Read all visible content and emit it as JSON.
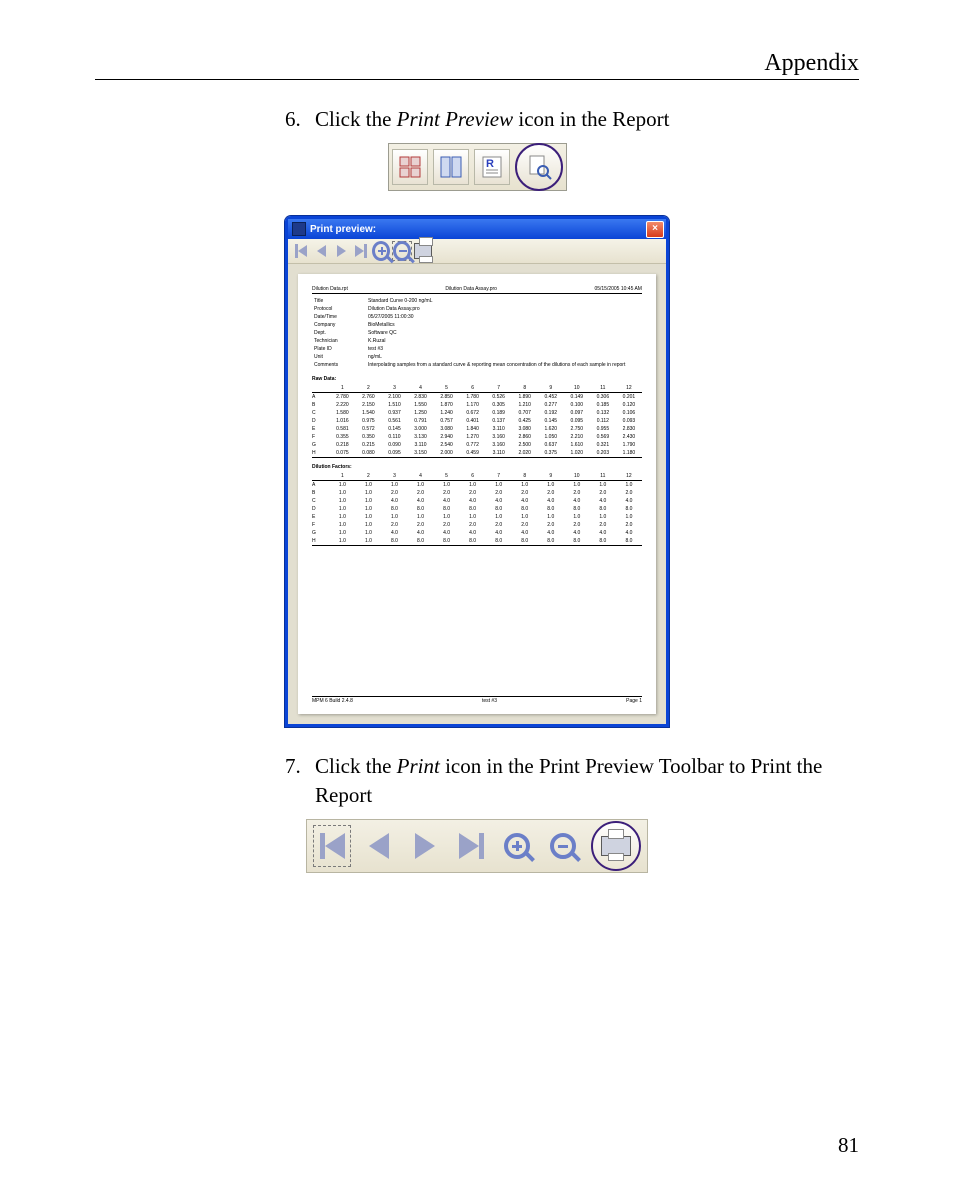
{
  "page_header": "Appendix",
  "page_number": "81",
  "step6": {
    "num": "6.",
    "prefix": "Click the ",
    "italic": "Print Preview",
    "suffix": " icon in the Report"
  },
  "step7": {
    "num": "7.",
    "prefix": "Click the ",
    "italic": "Print",
    "suffix": " icon in the Print Preview Toolbar to Print the Report"
  },
  "tbar1": {
    "btn1": "table-layout-icon",
    "btn2": "column-layout-icon",
    "btn3": "report-icon",
    "selected": "print-preview-icon"
  },
  "win": {
    "title": "Print preview:",
    "close": "×",
    "toolbar": [
      "first",
      "prev",
      "next",
      "last",
      "zoom-in",
      "zoom-out",
      "print"
    ]
  },
  "report": {
    "header_left": "Dilution Data.rpt",
    "header_center": "Dilution Data Assay.pro",
    "header_right": "05/15/2005 10:45 AM",
    "meta": [
      [
        "Title",
        "Standard Curve 0-200 ng/mL"
      ],
      [
        "Protocol",
        "Dilution Data Assay.pro"
      ],
      [
        "Date/Time",
        "05/27/2005 11:00:30"
      ],
      [
        "Company",
        "BioMetallics"
      ],
      [
        "Dept.",
        "Software QC"
      ],
      [
        "Technician",
        "K.Ruzal"
      ],
      [
        "Plate ID",
        "test #3"
      ],
      [
        "Unit",
        "ng/mL"
      ],
      [
        "Comments",
        "Interpolating samples from a standard curve & reporting mean concentration of the dilutions of each sample in report"
      ]
    ],
    "raw_label": "Raw Data:",
    "cols": [
      "",
      "1",
      "2",
      "3",
      "4",
      "5",
      "6",
      "7",
      "8",
      "9",
      "10",
      "11",
      "12"
    ],
    "raw_rows": [
      [
        "A",
        "2.780",
        "2.760",
        "2.100",
        "2.830",
        "2.850",
        "1.780",
        "0.526",
        "1.890",
        "0.452",
        "0.149",
        "0.306",
        "0.201"
      ],
      [
        "B",
        "2.220",
        "2.150",
        "1.510",
        "1.550",
        "1.870",
        "1.170",
        "0.305",
        "1.210",
        "0.277",
        "0.100",
        "0.185",
        "0.120"
      ],
      [
        "C",
        "1.580",
        "1.540",
        "0.937",
        "1.250",
        "1.240",
        "0.672",
        "0.189",
        "0.707",
        "0.192",
        "0.097",
        "0.132",
        "0.106"
      ],
      [
        "D",
        "1.016",
        "0.975",
        "0.561",
        "0.791",
        "0.757",
        "0.401",
        "0.137",
        "0.425",
        "0.145",
        "0.095",
        "0.112",
        "0.093"
      ],
      [
        "E",
        "0.581",
        "0.572",
        "0.145",
        "3.000",
        "3.080",
        "1.840",
        "3.110",
        "3.080",
        "1.620",
        "2.750",
        "0.955",
        "2.830"
      ],
      [
        "F",
        "0.355",
        "0.350",
        "0.110",
        "3.130",
        "2.940",
        "1.270",
        "3.160",
        "2.860",
        "1.050",
        "2.210",
        "0.569",
        "2.430"
      ],
      [
        "G",
        "0.218",
        "0.215",
        "0.090",
        "3.110",
        "2.540",
        "0.772",
        "3.160",
        "2.500",
        "0.637",
        "1.610",
        "0.321",
        "1.790"
      ],
      [
        "H",
        "0.075",
        "0.080",
        "0.095",
        "3.150",
        "2.000",
        "0.459",
        "3.110",
        "2.020",
        "0.375",
        "1.020",
        "0.203",
        "1.180"
      ]
    ],
    "dil_label": "Dilution Factors:",
    "dil_rows": [
      [
        "A",
        "1.0",
        "1.0",
        "1.0",
        "1.0",
        "1.0",
        "1.0",
        "1.0",
        "1.0",
        "1.0",
        "1.0",
        "1.0",
        "1.0"
      ],
      [
        "B",
        "1.0",
        "1.0",
        "2.0",
        "2.0",
        "2.0",
        "2.0",
        "2.0",
        "2.0",
        "2.0",
        "2.0",
        "2.0",
        "2.0"
      ],
      [
        "C",
        "1.0",
        "1.0",
        "4.0",
        "4.0",
        "4.0",
        "4.0",
        "4.0",
        "4.0",
        "4.0",
        "4.0",
        "4.0",
        "4.0"
      ],
      [
        "D",
        "1.0",
        "1.0",
        "8.0",
        "8.0",
        "8.0",
        "8.0",
        "8.0",
        "8.0",
        "8.0",
        "8.0",
        "8.0",
        "8.0"
      ],
      [
        "E",
        "1.0",
        "1.0",
        "1.0",
        "1.0",
        "1.0",
        "1.0",
        "1.0",
        "1.0",
        "1.0",
        "1.0",
        "1.0",
        "1.0"
      ],
      [
        "F",
        "1.0",
        "1.0",
        "2.0",
        "2.0",
        "2.0",
        "2.0",
        "2.0",
        "2.0",
        "2.0",
        "2.0",
        "2.0",
        "2.0"
      ],
      [
        "G",
        "1.0",
        "1.0",
        "4.0",
        "4.0",
        "4.0",
        "4.0",
        "4.0",
        "4.0",
        "4.0",
        "4.0",
        "4.0",
        "4.0"
      ],
      [
        "H",
        "1.0",
        "1.0",
        "8.0",
        "8.0",
        "8.0",
        "8.0",
        "8.0",
        "8.0",
        "8.0",
        "8.0",
        "8.0",
        "8.0"
      ]
    ],
    "footer_left": "MPM 6 Build 2.4.8",
    "footer_center": "test #3",
    "footer_right": "Page 1"
  },
  "tbar2": {
    "buttons": [
      "first",
      "prev",
      "next",
      "last",
      "zoom-in",
      "zoom-out"
    ],
    "selected": "print-icon"
  }
}
